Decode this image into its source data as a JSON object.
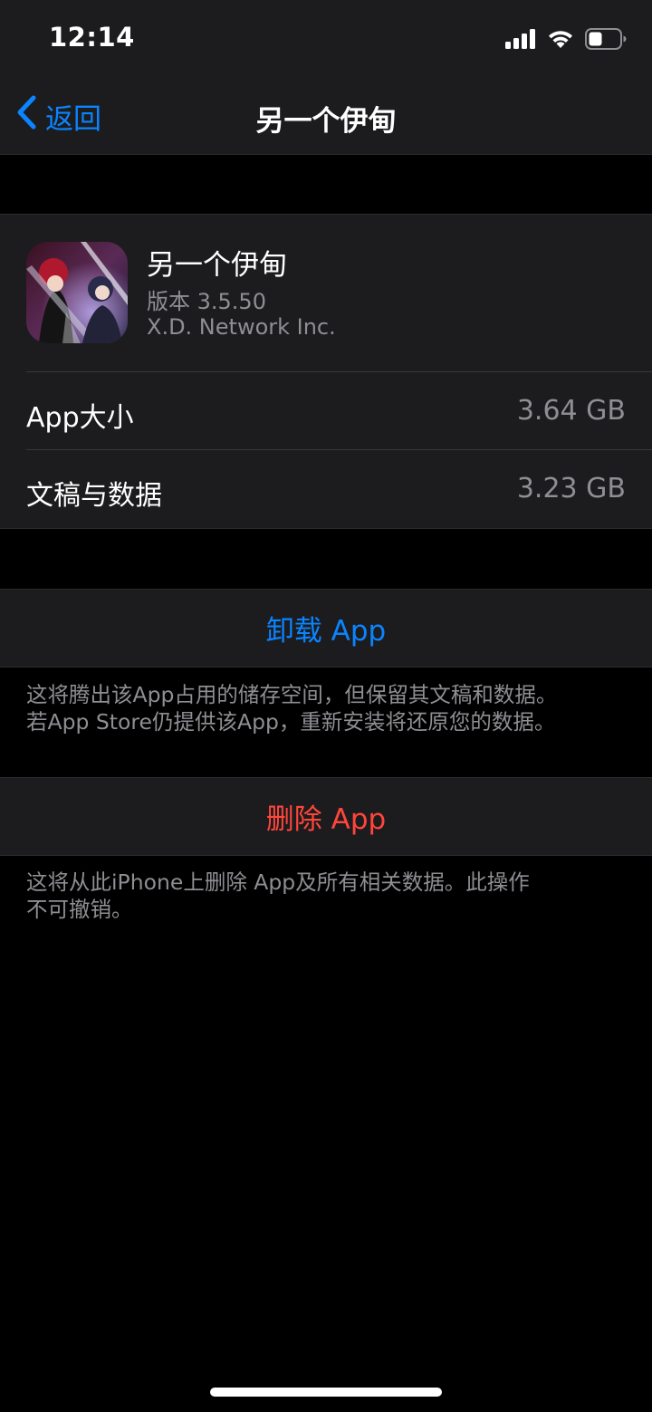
{
  "status_bar": {
    "time": "12:14"
  },
  "nav": {
    "back_label": "返回",
    "title": "另一个伊甸"
  },
  "app": {
    "name": "另一个伊甸",
    "version": "版本 3.5.50",
    "vendor": "X.D. Network Inc."
  },
  "storage_rows": [
    {
      "label": "App大小",
      "value": "3.64 GB"
    },
    {
      "label": "文稿与数据",
      "value": "3.23 GB"
    }
  ],
  "offload": {
    "label": "卸载 App",
    "footnote": "这将腾出该App占用的储存空间，但保留其文稿和数据。\n若App Store仍提供该App，重新安装将还原您的数据。"
  },
  "delete": {
    "label": "删除 App",
    "footnote": "这将从此iPhone上删除 App及所有相关数据。此操作\n不可撤销。"
  },
  "colors": {
    "accent": "#0a84ff",
    "destructive": "#ff453a",
    "secondary_text": "#8e8e93",
    "grouped_background": "#1c1c1e"
  }
}
